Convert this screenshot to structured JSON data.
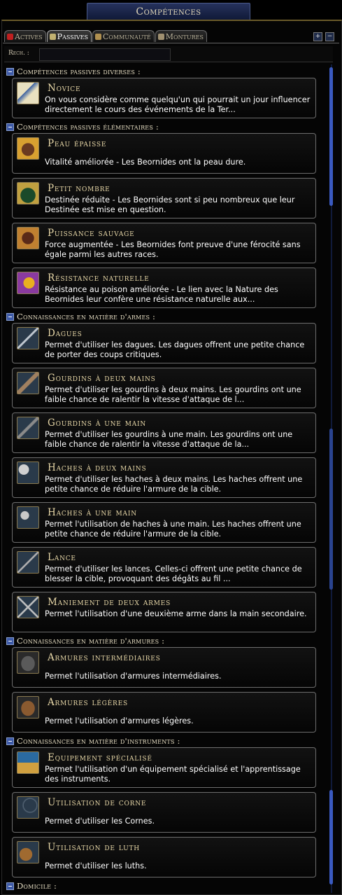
{
  "window": {
    "title": "Compétences"
  },
  "tabs": [
    {
      "label": "Actives",
      "icon": "red-icon",
      "color": "#c02020",
      "active": false
    },
    {
      "label": "Passives",
      "icon": "scroll-icon",
      "color": "#c0b070",
      "active": true
    },
    {
      "label": "Communauté",
      "icon": "leaf-icon",
      "color": "#b09050",
      "active": false
    },
    {
      "label": "Montures",
      "icon": "horse-icon",
      "color": "#a09070",
      "active": false
    }
  ],
  "controls": {
    "expand": "+",
    "collapse": "−"
  },
  "search": {
    "label": "Rech. :",
    "value": "",
    "placeholder": ""
  },
  "categories": [
    {
      "title": "Compétences passives diverses :"
    },
    {
      "title": "Compétences passives élémentaires :"
    },
    {
      "title": "Connaissances en matière d'armes :"
    },
    {
      "title": "Connaissances en matière d'armures :"
    },
    {
      "title": "Connaissances en matière d'instruments :"
    },
    {
      "title": "Domicile :"
    }
  ],
  "skills": [
    {
      "name": "Novice",
      "icon": "scroll-map-icon",
      "desc": "On vous considère comme quelqu'un qui pourrait un jour influencer directement le cours des événements de la Ter..."
    },
    {
      "name": "Peau épaisse",
      "icon": "bear-icon",
      "desc": "Vitalité améliorée - Les Beornides ont la peau dure."
    },
    {
      "name": "Petit nombre",
      "icon": "bear-silhouette-icon",
      "desc": "Destinée réduite - Les Beornides sont si peu nombreux que leur Destinée est mise en question."
    },
    {
      "name": "Puissance sauvage",
      "icon": "claw-icon",
      "desc": "Force augmentée - Les Beornides font preuve d'une férocité sans égale parmi les autres races."
    },
    {
      "name": "Résistance naturelle",
      "icon": "honeycomb-icon",
      "desc": "Résistance au poison améliorée - Le lien avec la Nature des Beornides leur confère une résistance naturelle aux..."
    },
    {
      "name": "Dagues",
      "icon": "dagger-icon",
      "desc": "Permet d'utiliser les dagues. Les dagues offrent une petite chance de porter des coups critiques."
    },
    {
      "name": "Gourdins à deux mains",
      "icon": "club-two-hand-icon",
      "desc": "Permet d'utiliser les gourdins à deux mains. Les gourdins ont une faible chance de ralentir la vitesse d'attaque de l..."
    },
    {
      "name": "Gourdins à une main",
      "icon": "club-one-hand-icon",
      "desc": "Permet d'utiliser les gourdins à une main. Les gourdins ont une faible chance de ralentir la vitesse d'attaque de la..."
    },
    {
      "name": "Haches à deux mains",
      "icon": "axe-two-hand-icon",
      "desc": "Permet d'utiliser les haches à deux mains. Les haches offrent une petite chance de réduire l'armure de la cible."
    },
    {
      "name": "Haches à une main",
      "icon": "axe-one-hand-icon",
      "desc": "Permet l'utilisation de haches à une main. Les haches offrent une petite chance de réduire l'armure de la cible."
    },
    {
      "name": "Lance",
      "icon": "spear-icon",
      "desc": "Permet d'utiliser les lances. Celles-ci offrent une petite chance de blesser la cible, provoquant des dégâts au fil ..."
    },
    {
      "name": "Maniement de deux armes",
      "icon": "crossed-swords-icon",
      "desc": "Permet l'utilisation d'une deuxième arme dans la main secondaire."
    },
    {
      "name": "Armures intermédiaires",
      "icon": "medium-armour-icon",
      "desc": "Permet l'utilisation d'armures intermédiaires."
    },
    {
      "name": "Armures légères",
      "icon": "light-armour-icon",
      "desc": "Permet l'utilisation d'armures légères."
    },
    {
      "name": "Equipement spécialisé",
      "icon": "instrument-kit-icon",
      "desc": "Permet l'utilisation d'un équipement spécialisé et l'apprentissage des instruments."
    },
    {
      "name": "Utilisation de corne",
      "icon": "horn-icon",
      "desc": "Permet d'utiliser les Cornes."
    },
    {
      "name": "Utilisation de luth",
      "icon": "lute-icon",
      "desc": "Permet d'utiliser les luths."
    }
  ],
  "colors": {
    "accent": "#3a5ac0",
    "text": "#ffffff",
    "title": "#e8d8a8"
  }
}
